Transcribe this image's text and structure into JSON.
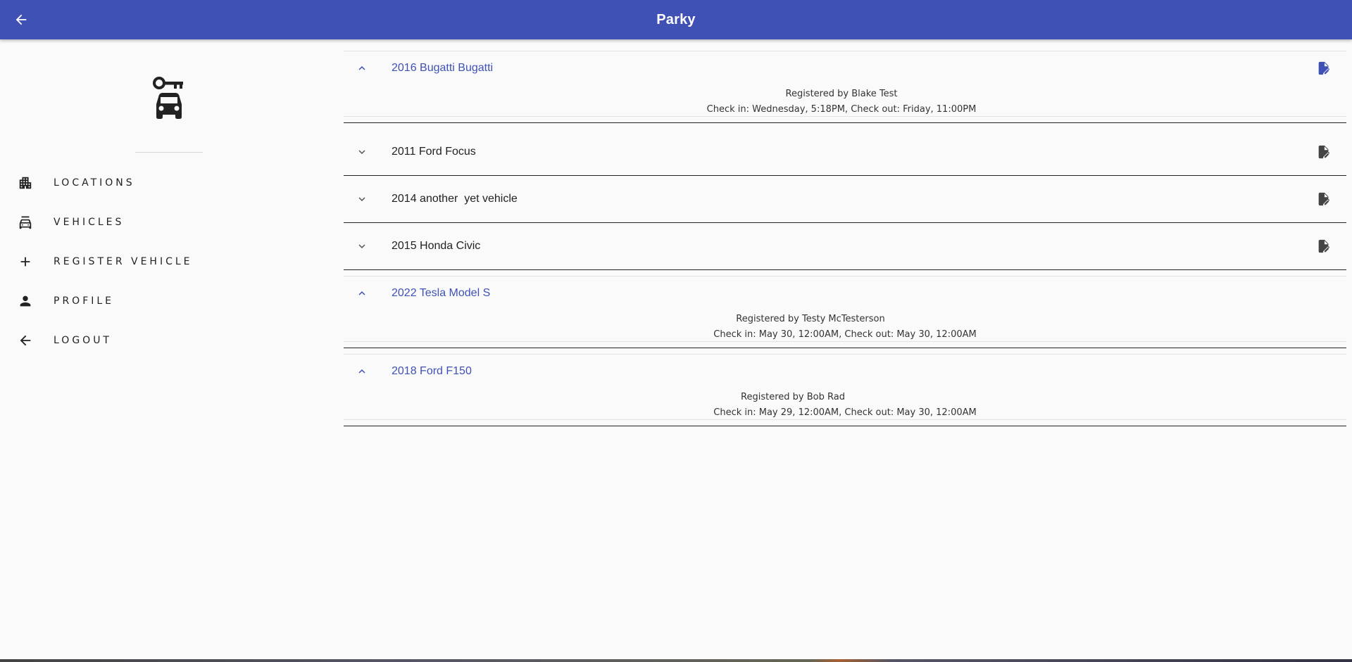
{
  "app": {
    "title": "Parky"
  },
  "colors": {
    "primary": "#3f51b5",
    "text": "#222222",
    "background": "#fafafa"
  },
  "sidebar": {
    "logo_icon": "car-key-icon",
    "items": [
      {
        "label": "LOCATIONS",
        "icon": "building-icon"
      },
      {
        "label": "VEHICLES",
        "icon": "car-icon"
      },
      {
        "label": "REGISTER VEHICLE",
        "icon": "plus-icon"
      },
      {
        "label": "PROFILE",
        "icon": "person-icon"
      },
      {
        "label": "LOGOUT",
        "icon": "arrow-left-icon"
      }
    ]
  },
  "vehicles": [
    {
      "title": "2016 Bugatti Bugatti",
      "expanded": true,
      "registered_by": "Registered by Blake Test",
      "schedule": "Check in: Wednesday, 5:18PM, Check out: Friday, 11:00PM"
    },
    {
      "title": "2011 Ford Focus",
      "expanded": false
    },
    {
      "title": "2014 another  yet vehicle",
      "expanded": false
    },
    {
      "title": "2015 Honda Civic",
      "expanded": false
    },
    {
      "title": "2022 Tesla Model S",
      "expanded": true,
      "registered_by": "Registered by Testy McTesterson",
      "schedule": "Check in: May 30, 12:00AM, Check out: May 30, 12:00AM"
    },
    {
      "title": "2018 Ford F150",
      "expanded": true,
      "registered_by": "Registered by Bob Rad",
      "schedule": "Check in: May 29, 12:00AM, Check out: May 30, 12:00AM"
    }
  ]
}
